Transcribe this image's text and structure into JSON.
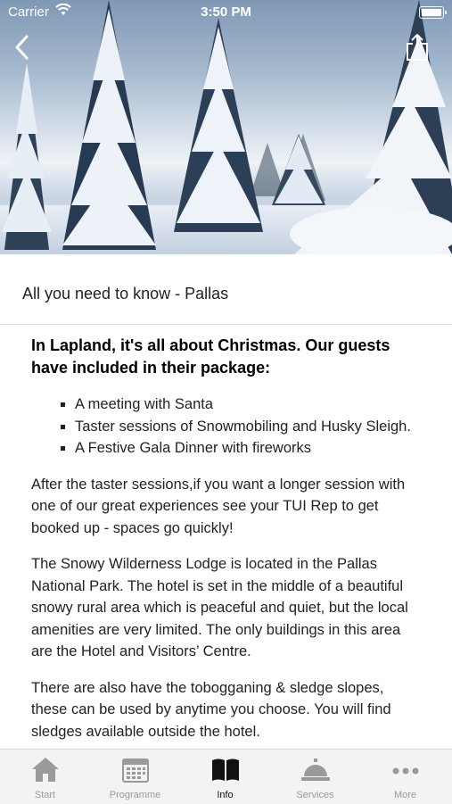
{
  "status_bar": {
    "carrier": "Carrier",
    "time": "3:50 PM"
  },
  "header": {
    "title": "All you need to know - Pallas"
  },
  "article": {
    "heading": "In Lapland, it's all about Christmas. Our guests have included in their package:",
    "bullets": [
      "A meeting with Santa",
      "Taster sessions of Snowmobiling and Husky Sleigh.",
      "A Festive Gala Dinner with fireworks"
    ],
    "paragraphs": [
      "After the taster sessions,if you want a longer session with one of our great experiences see your TUI Rep to get booked up - spaces go quickly!",
      "The Snowy Wilderness Lodge is located in the Pallas National Park. The hotel is set in the middle of a beautiful snowy rural area which is peaceful and quiet, but the local amenities are very limited. The only buildings in this area are the Hotel and Visitors’ Centre.",
      "There are also have the tobogganing & sledge slopes, these can be used by anytime you choose. You will find sledges available outside the hotel."
    ]
  },
  "tab_bar": {
    "tabs": [
      {
        "label": "Start",
        "icon": "home-icon",
        "active": false
      },
      {
        "label": "Programme",
        "icon": "calendar-icon",
        "active": false
      },
      {
        "label": "Info",
        "icon": "book-icon",
        "active": true
      },
      {
        "label": "Services",
        "icon": "service-bell-icon",
        "active": false
      },
      {
        "label": "More",
        "icon": "more-dots-icon",
        "active": false
      }
    ]
  },
  "colors": {
    "tab_active": "#111111",
    "tab_inactive": "#9a9a9a",
    "tab_background": "#f3f3f3"
  }
}
